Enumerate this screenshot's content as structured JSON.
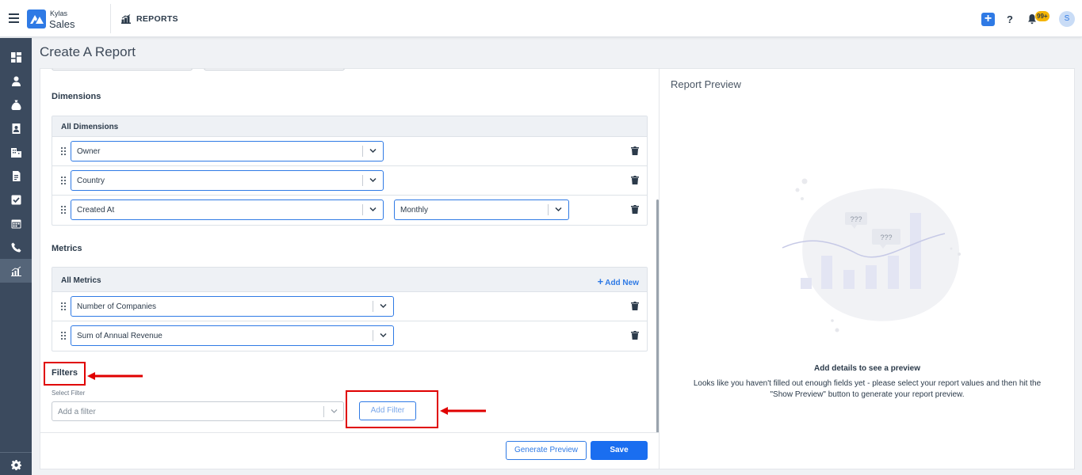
{
  "app": {
    "brand_line1": "Kylas",
    "brand_line2": "Sales",
    "section": "REPORTS",
    "notification_count": "99+",
    "user_initial": "S"
  },
  "header_icons": [
    "hamburger-icon",
    "plus-icon",
    "help-icon",
    "bell-icon"
  ],
  "header_help": "?",
  "header_plus": "+",
  "sidebar": {
    "items": [
      {
        "name": "dashboard-icon"
      },
      {
        "name": "contacts-icon"
      },
      {
        "name": "deals-icon"
      },
      {
        "name": "leads-icon"
      },
      {
        "name": "companies-icon"
      },
      {
        "name": "quotes-icon"
      },
      {
        "name": "tasks-icon"
      },
      {
        "name": "calendar-icon"
      },
      {
        "name": "calls-icon"
      },
      {
        "name": "reports-icon",
        "active": true
      }
    ],
    "bottom": "settings-icon"
  },
  "page": {
    "title": "Create A Report"
  },
  "dimensions": {
    "title": "Dimensions",
    "header": "All Dimensions",
    "rows": [
      {
        "field": "Owner"
      },
      {
        "field": "Country"
      },
      {
        "field": "Created At",
        "grouping": "Monthly"
      }
    ]
  },
  "metrics": {
    "title": "Metrics",
    "header": "All Metrics",
    "add_new": "Add New",
    "add_new_plus": "+",
    "rows": [
      {
        "field": "Number of Companies"
      },
      {
        "field": "Sum of Annual Revenue"
      }
    ]
  },
  "filters": {
    "title": "Filters",
    "select_label": "Select Filter",
    "placeholder": "Add a filter",
    "add_button": "Add Filter"
  },
  "actions": {
    "generate_preview": "Generate Preview",
    "save": "Save"
  },
  "preview": {
    "title": "Report Preview",
    "bubble_text": "???",
    "heading": "Add details to see a preview",
    "description": "Looks like you haven't filled out enough fields yet - please select your report values and then hit the \"Show Preview\" button to generate your report preview."
  },
  "colors": {
    "primary": "#2f7ae5",
    "sidebar": "#3b4a5e",
    "annotation": "#e00000"
  }
}
